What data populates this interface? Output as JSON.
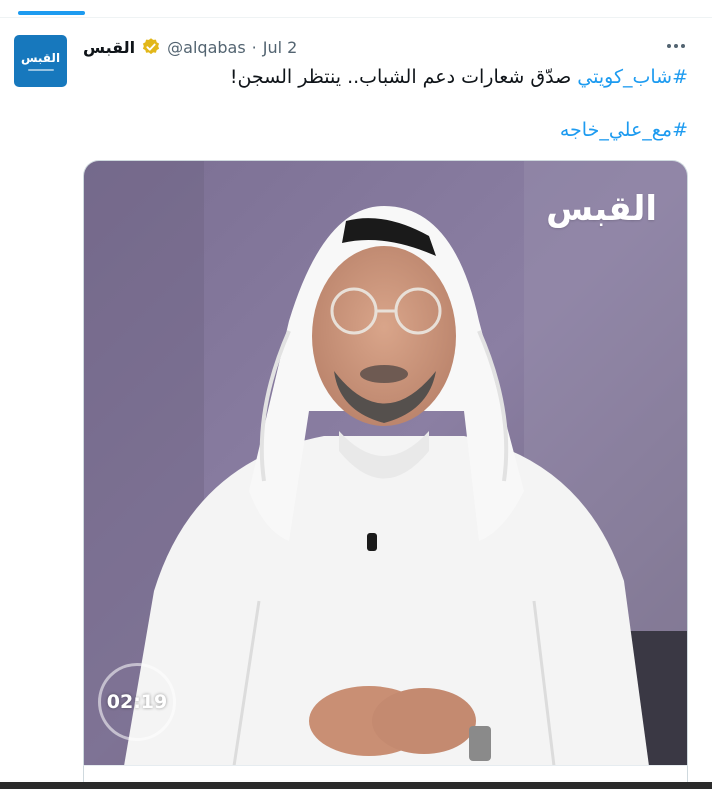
{
  "tweet": {
    "author": {
      "display_name": "القبس",
      "handle": "@alqabas",
      "verified": true,
      "avatar_text": "القبس"
    },
    "separator": "·",
    "date": "Jul 2",
    "text": {
      "hashtag1": "#شاب_كويتي",
      "body": " صدّق شعارات دعم الشباب.. ينتظر السجن!",
      "hashtag2": "#مع_علي_خاجه"
    },
    "media": {
      "type": "video",
      "logo_text": "القبس",
      "duration": "02:19"
    }
  },
  "icons": {
    "verified": "verified-badge-icon",
    "more": "more-options-icon"
  },
  "colors": {
    "accent": "#1d9bf0",
    "verified_gold": "#e2b719",
    "avatar_bg": "#1778bd",
    "text_secondary": "#536471"
  }
}
